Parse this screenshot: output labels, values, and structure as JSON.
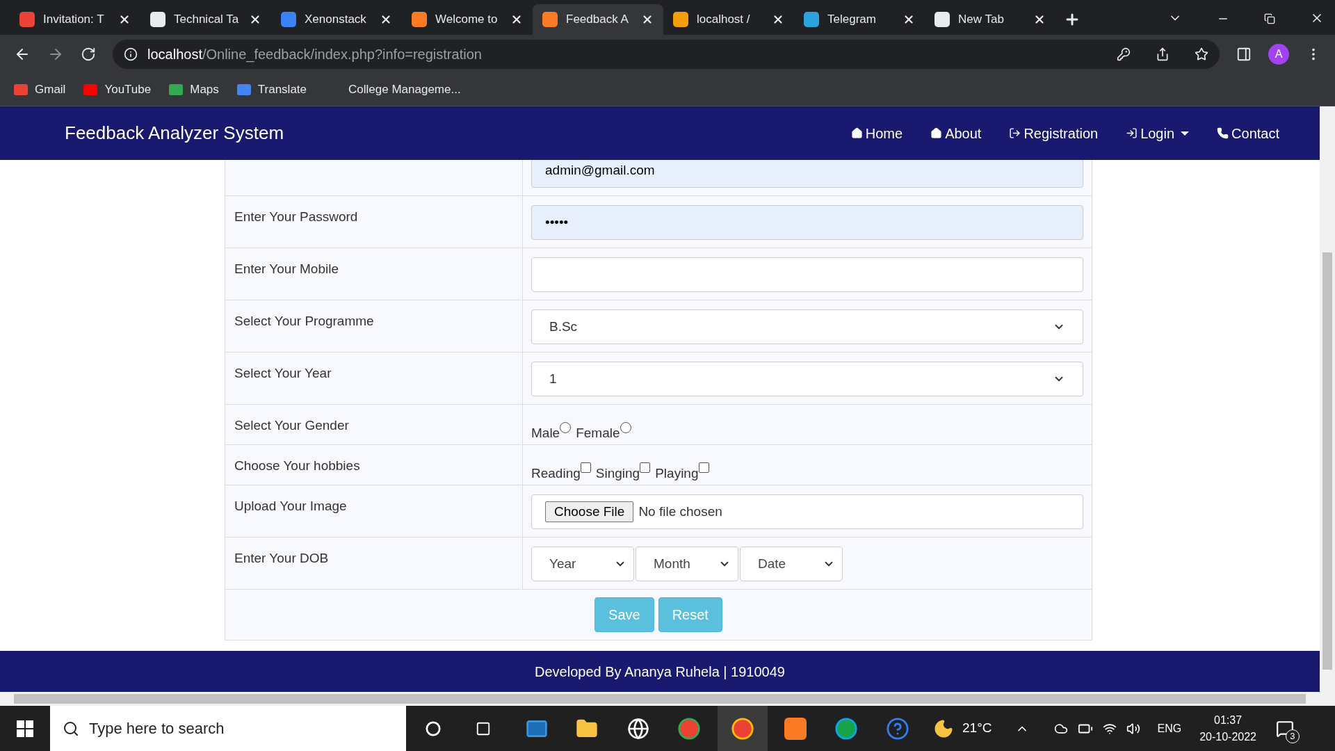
{
  "browser": {
    "tabs": [
      {
        "title": "Invitation: T",
        "selected": false,
        "color": "#ea4335"
      },
      {
        "title": "Technical Ta",
        "selected": false,
        "color": "#e8eaed"
      },
      {
        "title": "Xenonstack",
        "selected": false,
        "color": "#3b82f6"
      },
      {
        "title": "Welcome to",
        "selected": false,
        "color": "#fb7a24"
      },
      {
        "title": "Feedback A",
        "selected": true,
        "color": "#fb7a24"
      },
      {
        "title": "localhost /",
        "selected": false,
        "color": "#f59e0b"
      },
      {
        "title": "Telegram",
        "selected": false,
        "color": "#2aa3e0"
      },
      {
        "title": "New Tab",
        "selected": false,
        "color": "#e8eaed"
      }
    ],
    "address": {
      "host": "localhost",
      "path": "/Online_feedback/index.php?info=registration"
    },
    "profile": "A",
    "bookmarks": [
      {
        "label": "Gmail",
        "color": "#ea4335"
      },
      {
        "label": "YouTube",
        "color": "#ff0000"
      },
      {
        "label": "Maps",
        "color": "#34a853"
      },
      {
        "label": "Translate",
        "color": "#4285f4"
      },
      {
        "label": "College Manageme..."
      }
    ]
  },
  "navbar": {
    "brand": "Feedback Analyzer System",
    "links": [
      {
        "label": "Home",
        "kind": "home",
        "dropdown": false
      },
      {
        "label": "About",
        "kind": "home",
        "dropdown": false
      },
      {
        "label": "Registration",
        "kind": "signup",
        "dropdown": false
      },
      {
        "label": "Login",
        "kind": "login",
        "dropdown": true
      },
      {
        "label": "Contact",
        "kind": "phone",
        "dropdown": false
      }
    ]
  },
  "form": {
    "rows": [
      {
        "kind": "email",
        "value": "admin@gmail.com",
        "autofilled": true
      },
      {
        "label": "Enter Your Password",
        "kind": "password",
        "value": "•••••",
        "autofilled": true
      },
      {
        "label": "Enter Your Mobile",
        "kind": "text",
        "autofilled": false
      },
      {
        "label": "Select Your Programme",
        "kind": "select",
        "value": "B.Sc"
      },
      {
        "label": "Select Your Year",
        "kind": "select",
        "value": "1"
      },
      {
        "label": "Select Your Gender",
        "kind": "radio",
        "options": [
          {
            "label": "Male",
            "selected": false
          },
          {
            "label": "Female",
            "selected": false
          }
        ]
      },
      {
        "label": "Choose Your hobbies",
        "kind": "checkbox",
        "options": [
          {
            "label": "Reading",
            "checked": false
          },
          {
            "label": "Singing",
            "checked": false
          },
          {
            "label": "Playing",
            "checked": false
          }
        ]
      },
      {
        "label": "Upload Your Image",
        "kind": "file",
        "button": "Choose File",
        "status": "No file chosen"
      },
      {
        "label": "Enter Your DOB",
        "kind": "selects",
        "selects": [
          "Year",
          "Month",
          "Date"
        ]
      }
    ],
    "buttons": [
      "Save",
      "Reset"
    ]
  },
  "footer": "Developed By Ananya Ruhela | 1910049",
  "taskbar": {
    "search": "Type here to search",
    "weather": "21°C",
    "language": "ENG",
    "time": "01:37",
    "date": "20-10-2022",
    "notifications": "3"
  }
}
